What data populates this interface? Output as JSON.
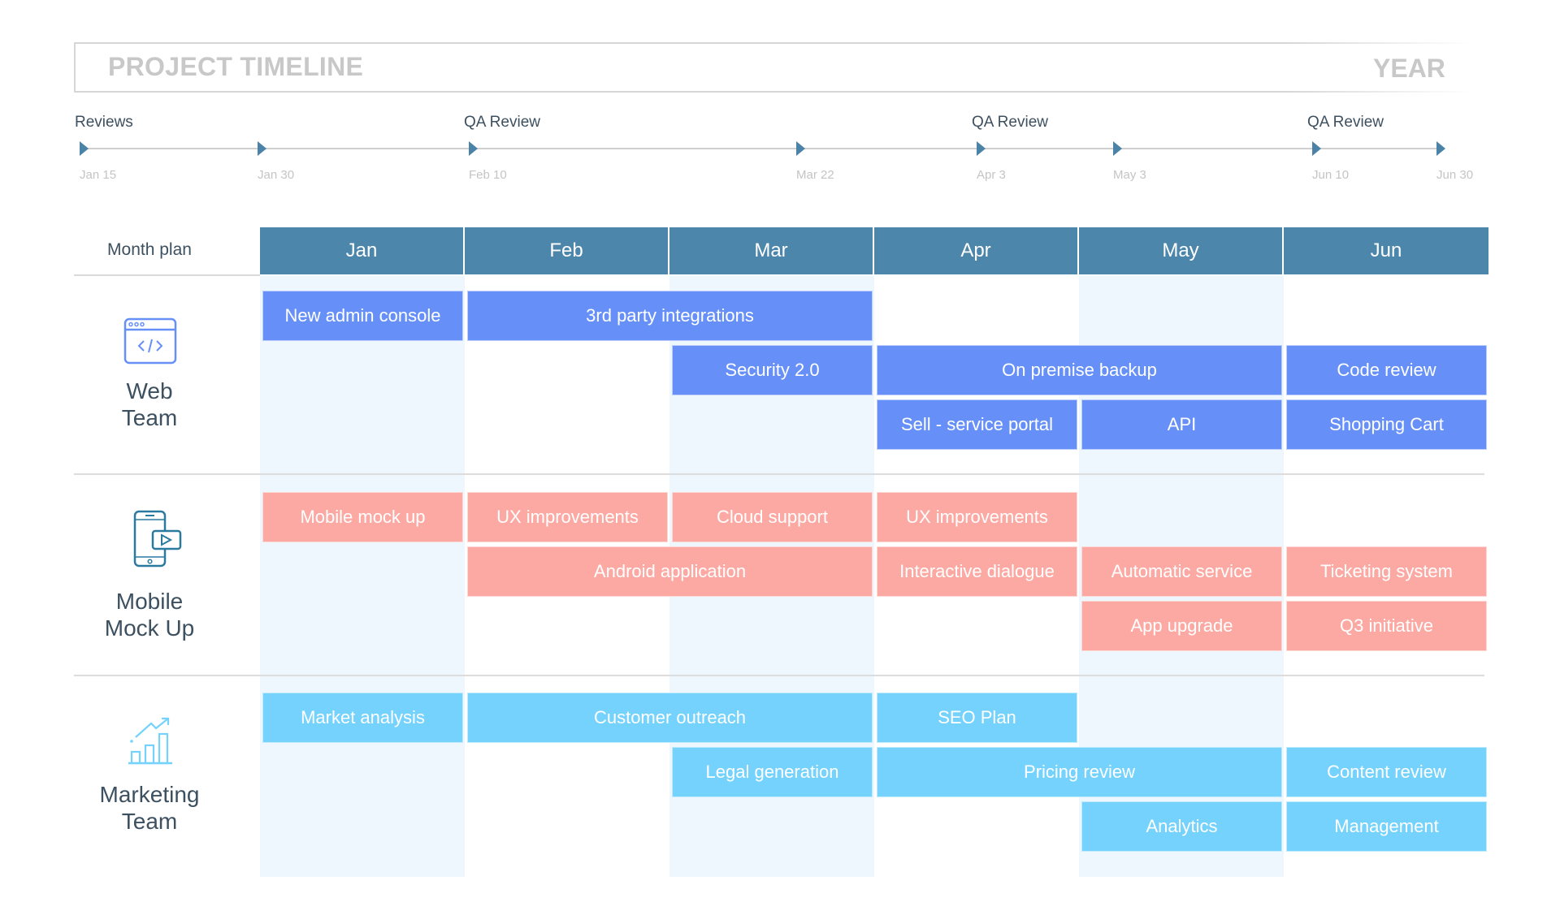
{
  "header": {
    "title": "PROJECT TIMELINE",
    "period": "YEAR"
  },
  "colors": {
    "month_header": "#4d86ab",
    "timeline_arrow": "#4b82a8",
    "web": "#6690f8",
    "mobile": "#fda9a3",
    "marketing": "#74d2fd",
    "column_shade": "#edf7fd"
  },
  "timeline": {
    "milestones": [
      {
        "label": "Reviews",
        "date": "Jan 15"
      },
      {
        "label": "",
        "date": "Jan 30"
      },
      {
        "label": "QA Review",
        "date": "Feb 10"
      },
      {
        "label": "",
        "date": "Mar 22"
      },
      {
        "label": "QA Review",
        "date": "Apr 3"
      },
      {
        "label": "",
        "date": "May 3"
      },
      {
        "label": "QA Review",
        "date": "Jun 10"
      },
      {
        "label": "",
        "date": "Jun 30"
      }
    ]
  },
  "month_plan": {
    "label": "Month plan",
    "months": [
      "Jan",
      "Feb",
      "Mar",
      "Apr",
      "May",
      "Jun"
    ],
    "shaded_months": [
      "Jan",
      "Mar",
      "May"
    ]
  },
  "teams": [
    {
      "name_line1": "Web",
      "name_line2": "Team",
      "icon": "browser-code-icon",
      "color_key": "web",
      "tasks": [
        {
          "label": "New admin console",
          "start": "Jan",
          "end": "Jan",
          "row": 0
        },
        {
          "label": "3rd party integrations",
          "start": "Feb",
          "end": "Mar",
          "row": 0
        },
        {
          "label": "Security 2.0",
          "start": "Mar",
          "end": "Mar",
          "row": 1
        },
        {
          "label": "On premise backup",
          "start": "Apr",
          "end": "May",
          "row": 1
        },
        {
          "label": "Code review",
          "start": "Jun",
          "end": "Jun",
          "row": 1
        },
        {
          "label": "Sell - service portal",
          "start": "Apr",
          "end": "Apr",
          "row": 2
        },
        {
          "label": "API",
          "start": "May",
          "end": "May",
          "row": 2
        },
        {
          "label": "Shopping Cart",
          "start": "Jun",
          "end": "Jun",
          "row": 2
        }
      ]
    },
    {
      "name_line1": "Mobile",
      "name_line2": "Mock Up",
      "icon": "mobile-video-icon",
      "color_key": "mobile",
      "tasks": [
        {
          "label": "Mobile mock up",
          "start": "Jan",
          "end": "Jan",
          "row": 0
        },
        {
          "label": "UX improvements",
          "start": "Feb",
          "end": "Feb",
          "row": 0
        },
        {
          "label": "Cloud support",
          "start": "Mar",
          "end": "Mar",
          "row": 0
        },
        {
          "label": "UX improvements",
          "start": "Apr",
          "end": "Apr",
          "row": 0
        },
        {
          "label": "Android application",
          "start": "Feb",
          "end": "Mar",
          "row": 1
        },
        {
          "label": "Interactive dialogue",
          "start": "Apr",
          "end": "Apr",
          "row": 1
        },
        {
          "label": "Automatic service",
          "start": "May",
          "end": "May",
          "row": 1
        },
        {
          "label": "Ticketing system",
          "start": "Jun",
          "end": "Jun",
          "row": 1
        },
        {
          "label": "App upgrade",
          "start": "May",
          "end": "May",
          "row": 2
        },
        {
          "label": "Q3 initiative",
          "start": "Jun",
          "end": "Jun",
          "row": 2
        }
      ]
    },
    {
      "name_line1": "Marketing",
      "name_line2": "Team",
      "icon": "growth-chart-icon",
      "color_key": "marketing",
      "tasks": [
        {
          "label": "Market analysis",
          "start": "Jan",
          "end": "Jan",
          "row": 0
        },
        {
          "label": "Customer outreach",
          "start": "Feb",
          "end": "Mar",
          "row": 0
        },
        {
          "label": "SEO Plan",
          "start": "Apr",
          "end": "Apr",
          "row": 0
        },
        {
          "label": "Legal generation",
          "start": "Mar",
          "end": "Mar",
          "row": 1
        },
        {
          "label": "Pricing review",
          "start": "Apr",
          "end": "May",
          "row": 1
        },
        {
          "label": "Content review",
          "start": "Jun",
          "end": "Jun",
          "row": 1
        },
        {
          "label": "Analytics",
          "start": "May",
          "end": "May",
          "row": 2
        },
        {
          "label": "Management",
          "start": "Jun",
          "end": "Jun",
          "row": 2
        }
      ]
    }
  ]
}
